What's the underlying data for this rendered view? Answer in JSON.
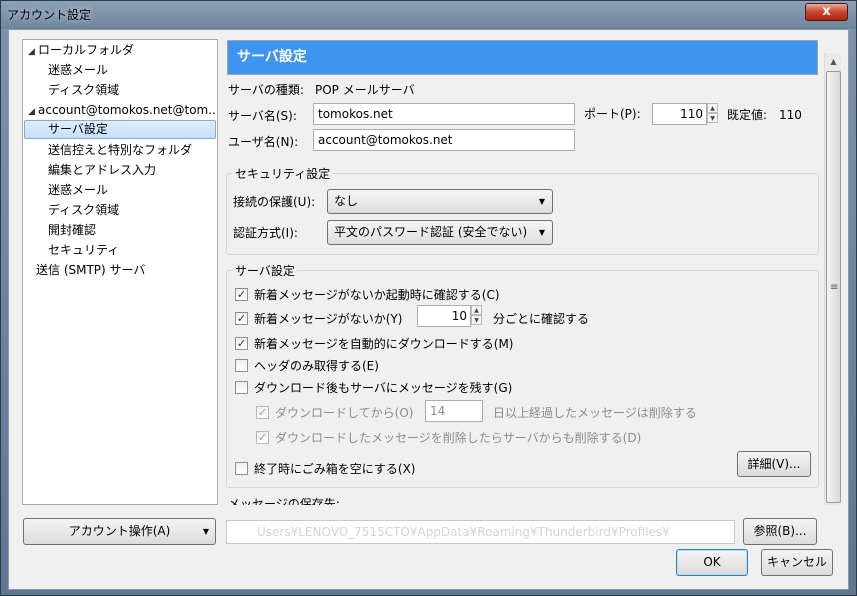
{
  "window": {
    "title": "アカウント設定",
    "close_glyph": "x"
  },
  "tree": {
    "items": [
      {
        "label": "ローカルフォルダ"
      },
      {
        "label": "迷惑メール"
      },
      {
        "label": "ディスク領域"
      },
      {
        "label": "account@tomokos.net@tom..."
      },
      {
        "label": "サーバ設定"
      },
      {
        "label": "送信控えと特別なフォルダ"
      },
      {
        "label": "編集とアドレス入力"
      },
      {
        "label": "迷惑メール"
      },
      {
        "label": "ディスク領域"
      },
      {
        "label": "開封確認"
      },
      {
        "label": "セキュリティ"
      },
      {
        "label": "送信 (SMTP) サーバ"
      }
    ],
    "selected": "サーバ設定"
  },
  "account_actions_label": "アカウント操作(A)",
  "panel": {
    "header": "サーバ設定",
    "server_type_label": "サーバの種類:",
    "server_type_value": "POP メールサーバ",
    "server_name_label": "サーバ名(S):",
    "server_name_value": "tomokos.net",
    "port_label": "ポート(P):",
    "port_value": "110",
    "default_label": "既定値:",
    "default_value": "110",
    "user_name_label": "ユーザ名(N):",
    "user_name_value": "account@tomokos.net",
    "security": {
      "title": "セキュリティ設定",
      "connection_label": "接続の保護(U):",
      "connection_value": "なし",
      "auth_label": "認証方式(I):",
      "auth_value": "平文のパスワード認証 (安全でない)"
    },
    "server_settings": {
      "title": "サーバ設定",
      "check_on_startup": {
        "label": "新着メッセージがないか起動時に確認する(C)",
        "checked": true
      },
      "check_every": {
        "label": "新着メッセージがないか(Y)",
        "checked": true,
        "minutes": "10",
        "suffix": "分ごとに確認する"
      },
      "auto_download": {
        "label": "新着メッセージを自動的にダウンロードする(M)",
        "checked": true
      },
      "headers_only": {
        "label": "ヘッダのみ取得する(E)",
        "checked": false
      },
      "leave_on_server": {
        "label": "ダウンロード後もサーバにメッセージを残す(G)",
        "checked": false
      },
      "delete_after": {
        "label": "ダウンロードしてから(O)",
        "checked": true,
        "days": "14",
        "suffix": "日以上経過したメッセージは削除する"
      },
      "delete_when_deleted": {
        "label": "ダウンロードしたメッセージを削除したらサーバからも削除する(D)",
        "checked": true
      },
      "empty_trash": {
        "label": "終了時にごみ箱を空にする(X)",
        "checked": false
      },
      "advanced_label": "詳細(V)..."
    },
    "storage_label": "メッセージの保存先:",
    "storage_path": "Users¥LENOVO_7515CTO¥AppData¥Roaming¥Thunderbird¥Profiles¥",
    "browse_label": "参照(B)..."
  },
  "ok_label": "OK",
  "cancel_label": "キャンセル",
  "colors": {
    "header_bg": "#3d95ef",
    "selection": "#c6e0fa"
  }
}
